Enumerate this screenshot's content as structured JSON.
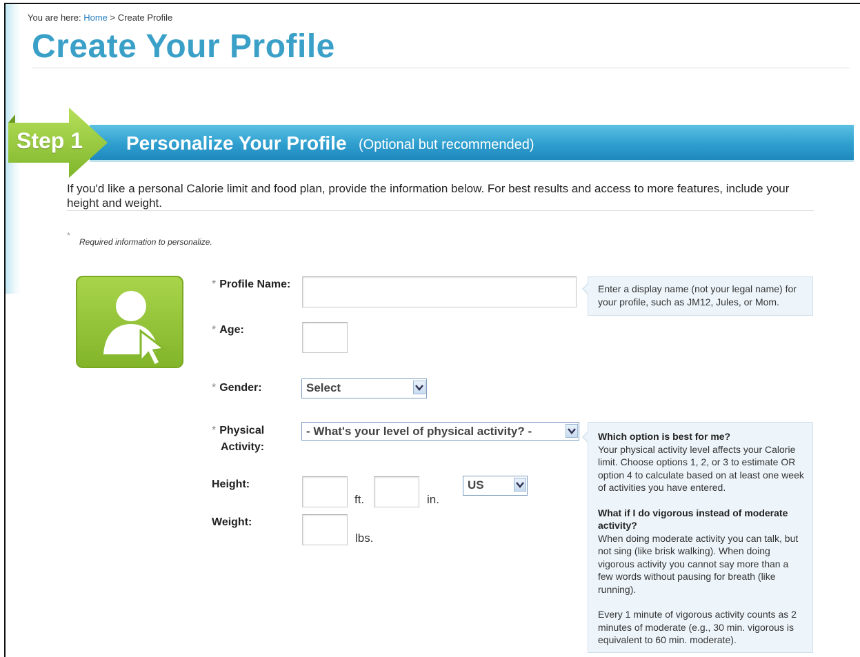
{
  "breadcrumb": {
    "prefix": "You are here:",
    "home": "Home",
    "separator": ">",
    "current": "Create Profile"
  },
  "page_title": "Create Your Profile",
  "step": {
    "label": "Step 1",
    "heading": "Personalize Your Profile",
    "note": "(Optional but recommended)"
  },
  "intro": "If you'd like a personal Calorie limit and food plan, provide the information below. For best results and access to more features, include your height and weight.",
  "required_note": {
    "star": "*",
    "text": "Required information to personalize."
  },
  "form": {
    "required_marker": "*",
    "profile_name": {
      "label": "Profile Name:",
      "value": ""
    },
    "age": {
      "label": "Age:",
      "value": ""
    },
    "gender": {
      "label": "Gender:",
      "selected": "Select"
    },
    "activity": {
      "label_line1": "Physical",
      "label_line2": "Activity:",
      "selected": "- What's your level of physical activity? -"
    },
    "height": {
      "label": "Height:",
      "ft_unit": "ft.",
      "in_unit": "in.",
      "unit_system": "US"
    },
    "weight": {
      "label": "Weight:",
      "unit": "lbs."
    }
  },
  "help": {
    "profile_name": "Enter a display name (not your legal name) for your profile, such as JM12, Jules, or Mom.",
    "activity_q1": "Which option is best for me?",
    "activity_a1": "Your physical activity level affects your Calorie limit. Choose options 1, 2, or 3 to estimate OR option 4 to calculate based on at least one week of activities you have entered.",
    "activity_q2": "What if I do vigorous instead of moderate activity?",
    "activity_a2": "When doing moderate activity you can talk, but not sing (like brisk walking). When doing vigorous activity you cannot say more than a few words without pausing for breath (like running).",
    "activity_a3": "Every 1 minute of vigorous activity counts as 2 minutes of moderate (e.g., 30 min. vigorous is equivalent to 60 min. moderate)."
  },
  "colors": {
    "title": "#3aa0c8",
    "banner": "#2f9fcf",
    "step_green": "#8cc63f",
    "help_bg": "#eef5fa"
  },
  "icons": {
    "avatar": "user-select-icon",
    "dropdown": "chevron-down-icon"
  }
}
